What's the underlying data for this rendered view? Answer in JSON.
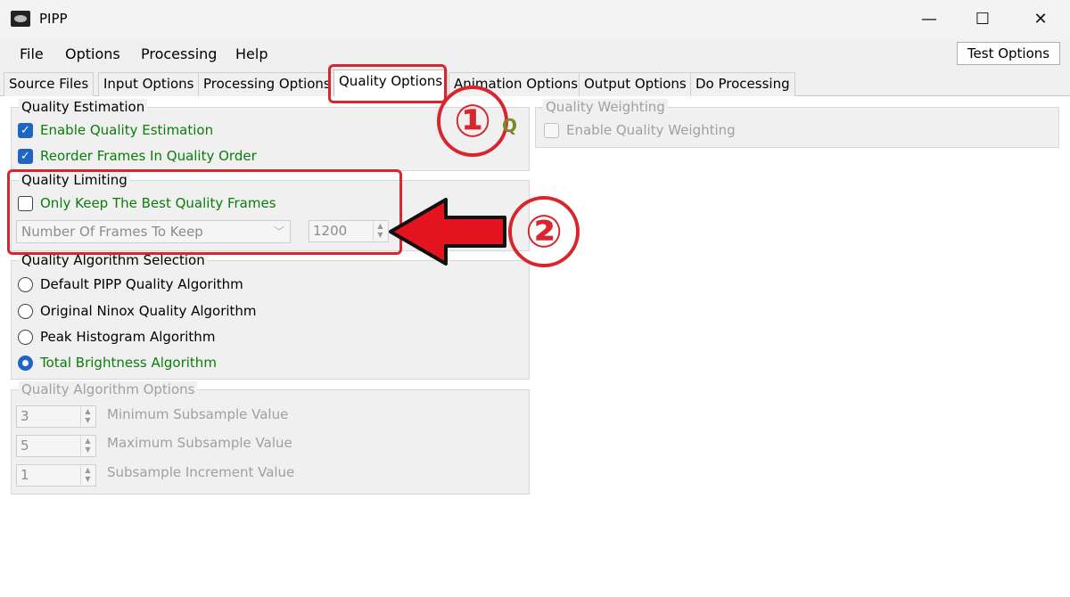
{
  "window": {
    "title": "PIPP",
    "minimize": "—",
    "maximize": "☐",
    "close": "✕"
  },
  "menu": [
    "File",
    "Options",
    "Processing",
    "Help"
  ],
  "test_options_label": "Test Options",
  "tabs": [
    "Source Files",
    "Input Options",
    "Processing Options",
    "Quality Options",
    "Animation Options",
    "Output Options",
    "Do Processing"
  ],
  "active_tab": "Quality Options",
  "quality_estimation": {
    "title": "Quality Estimation",
    "enable_label": "Enable Quality Estimation",
    "enable_checked": true,
    "reorder_label": "Reorder Frames In Quality Order",
    "reorder_checked": true
  },
  "quality_weighting": {
    "title": "Quality Weighting",
    "enable_label": "Enable Quality Weighting",
    "enable_checked": false
  },
  "quality_limiting": {
    "title": "Quality Limiting",
    "keep_best_label": "Only Keep The Best Quality Frames",
    "keep_best_checked": false,
    "mode_select_value": "Number Of Frames To Keep",
    "frames_value": "1200"
  },
  "algorithm_selection": {
    "title": "Quality Algorithm Selection",
    "options": [
      "Default PIPP Quality Algorithm",
      "Original Ninox Quality Algorithm",
      "Peak Histogram Algorithm",
      "Total Brightness Algorithm"
    ],
    "selected": "Total Brightness Algorithm"
  },
  "algorithm_options": {
    "title": "Quality Algorithm Options",
    "min_value": "3",
    "min_label": "Minimum Subsample Value",
    "max_value": "5",
    "max_label": "Maximum Subsample Value",
    "inc_value": "1",
    "inc_label": "Subsample Increment Value"
  },
  "annotations": {
    "step1": "①",
    "step2": "②",
    "q_glyph": "Q"
  },
  "colors": {
    "accent": "#1f65c4",
    "annotation": "#d7262e",
    "enabled_text": "#0a7d0a"
  }
}
